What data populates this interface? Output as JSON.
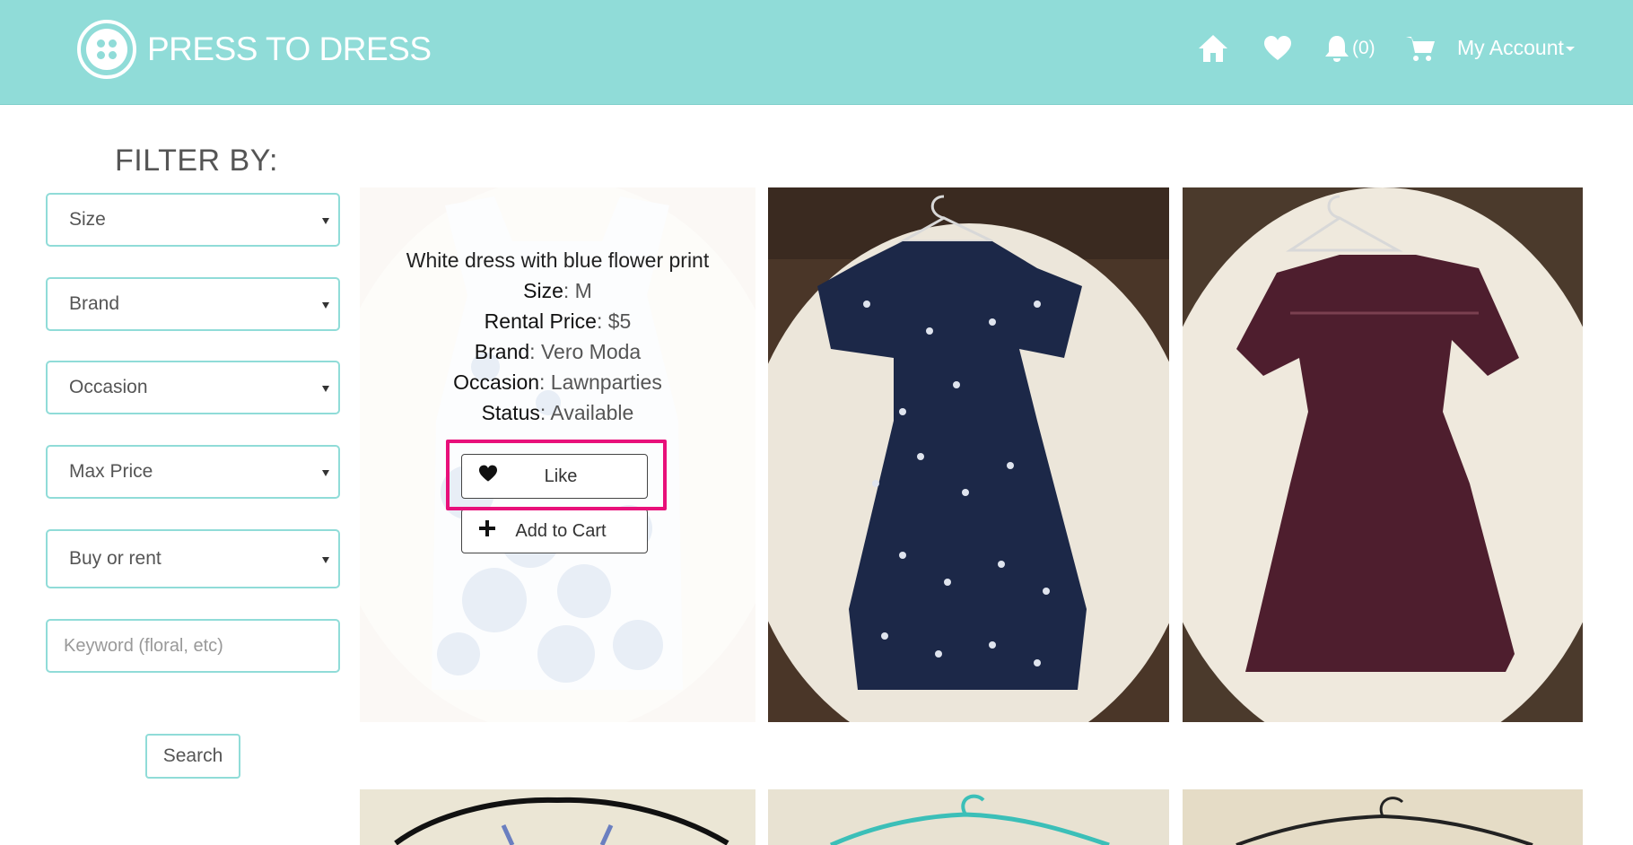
{
  "header": {
    "brand": "PRESS TO DRESS",
    "notifications_count": "(0)",
    "account_label": "My Account",
    "icons": [
      "logo-icon",
      "home-icon",
      "heart-icon",
      "bell-icon",
      "cart-icon"
    ]
  },
  "sidebar": {
    "title": "FILTER BY:",
    "filters": [
      "Size",
      "Brand",
      "Occasion",
      "Max Price",
      "Buy or rent"
    ],
    "keyword_placeholder": "Keyword (floral, etc)",
    "search_label": "Search"
  },
  "product": {
    "title": "White dress with blue flower print",
    "size_label": "Size",
    "size_value": ": M",
    "price_label": "Rental Price",
    "price_value": ": $5",
    "brand_label": "Brand",
    "brand_value": ": Vero Moda",
    "occasion_label": "Occasion",
    "occasion_value": ": Lawnparties",
    "status_label": "Status",
    "status_value": ": Available",
    "like_label": "Like",
    "cart_label": "Add to Cart"
  },
  "colors": {
    "header": "#90dcd8",
    "highlight": "#e8107a"
  }
}
